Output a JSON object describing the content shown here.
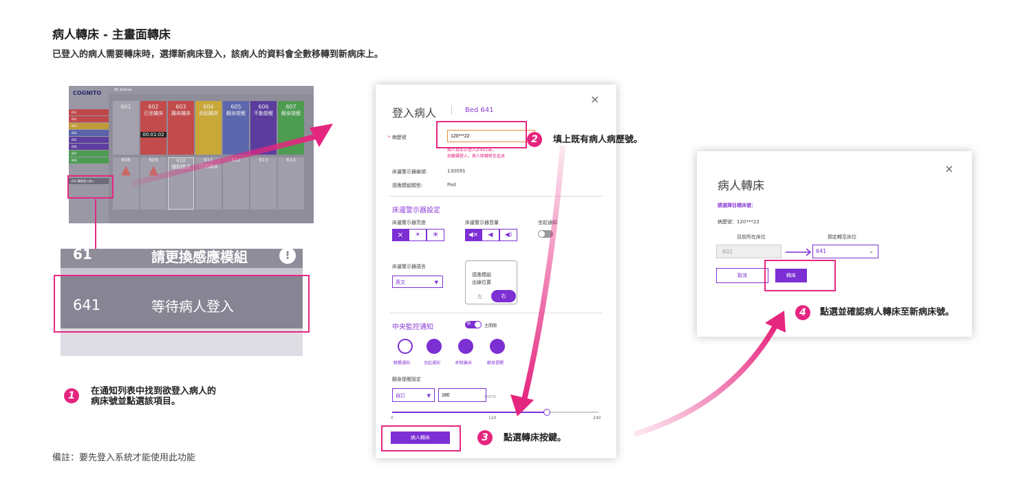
{
  "page": {
    "title": "病人轉床 - 主畫面轉床",
    "subtitle": "已登入的病人需要轉床時，選擇新病床登入，該病人的資料會全數移轉到新病床上。",
    "note": "備註：要先登入系統才能使用此功能"
  },
  "steps": [
    {
      "num": "1",
      "text_line1": "在通知列表中找到欲登入病人的",
      "text_line2": "病床號並點選該項目。"
    },
    {
      "num": "2",
      "text": "填上既有病人病歷號。"
    },
    {
      "num": "3",
      "text": "點選轉床按鍵。"
    },
    {
      "num": "4",
      "text": "點選並確認病人轉床至新病床號。"
    }
  ],
  "screen1": {
    "logo": "COGNITO",
    "station": "6S Station",
    "beds_top": [
      "601",
      "602",
      "603",
      "604",
      "605",
      "606",
      "607"
    ],
    "beds_top_status": [
      "",
      "已坐離床",
      "離床離床",
      "坐起離床",
      "翻身提醒",
      "不動提醒",
      "翻身提醒"
    ],
    "beds_bottom": [
      "608",
      "609",
      "610",
      "611",
      "612",
      "613",
      "614"
    ],
    "bed_610_status": "讀取模式",
    "bed_611_status": "已坐離床",
    "timer": "00:01:02",
    "side_items": [
      "601",
      "602",
      "603",
      "604",
      "605",
      "606",
      "607",
      "608",
      "641"
    ],
    "side_last": "轉換登入病人"
  },
  "zoom": {
    "row_prev_bed": "61",
    "row_prev_text": "請更換感應模組",
    "bed": "641",
    "status": "等待病人登入"
  },
  "dialog1": {
    "title": "登入病人",
    "bed": "Bed 641",
    "close_icon": "close-icon",
    "mrn_label": "病歷號",
    "mrn_value": "120***22",
    "warn1": "病人目前正登入於601床。",
    "warn2": "如繼續登入，病人將轉移至此床",
    "device_id_label": "床邊警示器編號:",
    "device_id": "130091",
    "sensor_type_label": "感應模組類型:",
    "sensor_type": "Pad",
    "section_alarm": "床邊警示器設定",
    "brightness_label": "床邊警示器亮度",
    "volume_label": "床邊警示器音量",
    "sit_notify_label": "坐起通知",
    "lang_label": "床邊警示器語言",
    "lang_value": "英文",
    "sensor_pos_label1": "感應模組",
    "sensor_pos_label2": "出線位置",
    "pos_left": "左",
    "pos_right": "右",
    "central_label": "中央監控通知",
    "toggle_on": "開",
    "main_switch": "主開關",
    "notify_items": [
      "甦醒通知",
      "坐起通知",
      "即將離床",
      "翻身提醒"
    ],
    "turn_setting": "翻身提醒設定",
    "custom": "自訂",
    "minutes_value": "180",
    "mins": "mins",
    "slider_min": "0",
    "slider_mid": "120",
    "slider_max": "240",
    "transfer_btn": "病人轉床"
  },
  "dialog2": {
    "title": "病人轉床",
    "close_icon": "close-icon",
    "prompt": "請選擇目標床號：",
    "mrn": "病歷號：120***22",
    "current_label": "目前所在床位",
    "target_label": "預定轉至床位",
    "current_bed": "601",
    "target_bed": "641",
    "cancel": "取消",
    "confirm": "轉床"
  },
  "colors": {
    "accent": "#e5267f",
    "purple": "#7c2fd3"
  }
}
